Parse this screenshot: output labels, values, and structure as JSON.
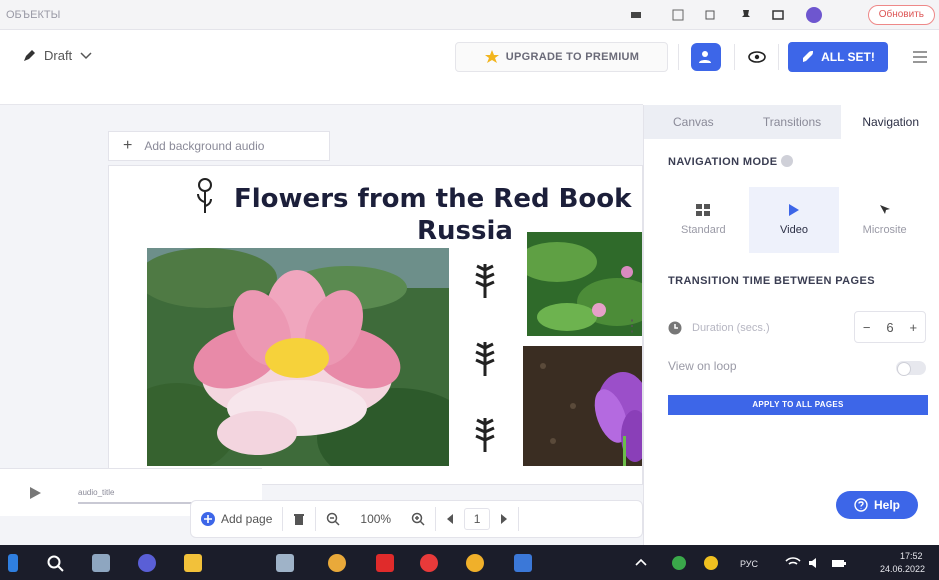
{
  "browser": {
    "tab_text": "ОБЪЕКТЫ",
    "action_pill": "Обновить"
  },
  "toolbar": {
    "draft_label": "Draft",
    "upgrade_label": "UPGRADE TO PREMIUM",
    "all_set_label": "ALL SET!"
  },
  "canvas": {
    "add_audio_label": "Add background audio",
    "title_line1": "Flowers from the Red Book",
    "title_line2": "Russia"
  },
  "timeline": {
    "audio_track_label": "audio_title"
  },
  "bottom_tools": {
    "add_page_label": "Add page",
    "zoom_value": "100%",
    "page_number": "1"
  },
  "panel": {
    "tabs": [
      {
        "label": "Canvas"
      },
      {
        "label": "Transitions"
      },
      {
        "label": "Navigation",
        "active": true
      }
    ],
    "nav_mode_title": "NAVIGATION MODE",
    "modes": [
      {
        "label": "Standard",
        "icon": "grid-icon"
      },
      {
        "label": "Video",
        "icon": "play-icon",
        "active": true
      },
      {
        "label": "Microsite",
        "icon": "cursor-icon"
      }
    ],
    "transition_title": "TRANSITION TIME BETWEEN PAGES",
    "duration_label": "Duration (secs.)",
    "duration_value": "6",
    "loop_label": "View on loop",
    "apply_label": "APPLY TO ALL PAGES",
    "help_label": "Help"
  },
  "taskbar": {
    "lang": "РУС",
    "time": "17:52",
    "date": "24.06.2022"
  },
  "colors": {
    "accent": "#3d66e8",
    "taskbar": "#1b1d2a",
    "title": "#1c1f3a"
  }
}
